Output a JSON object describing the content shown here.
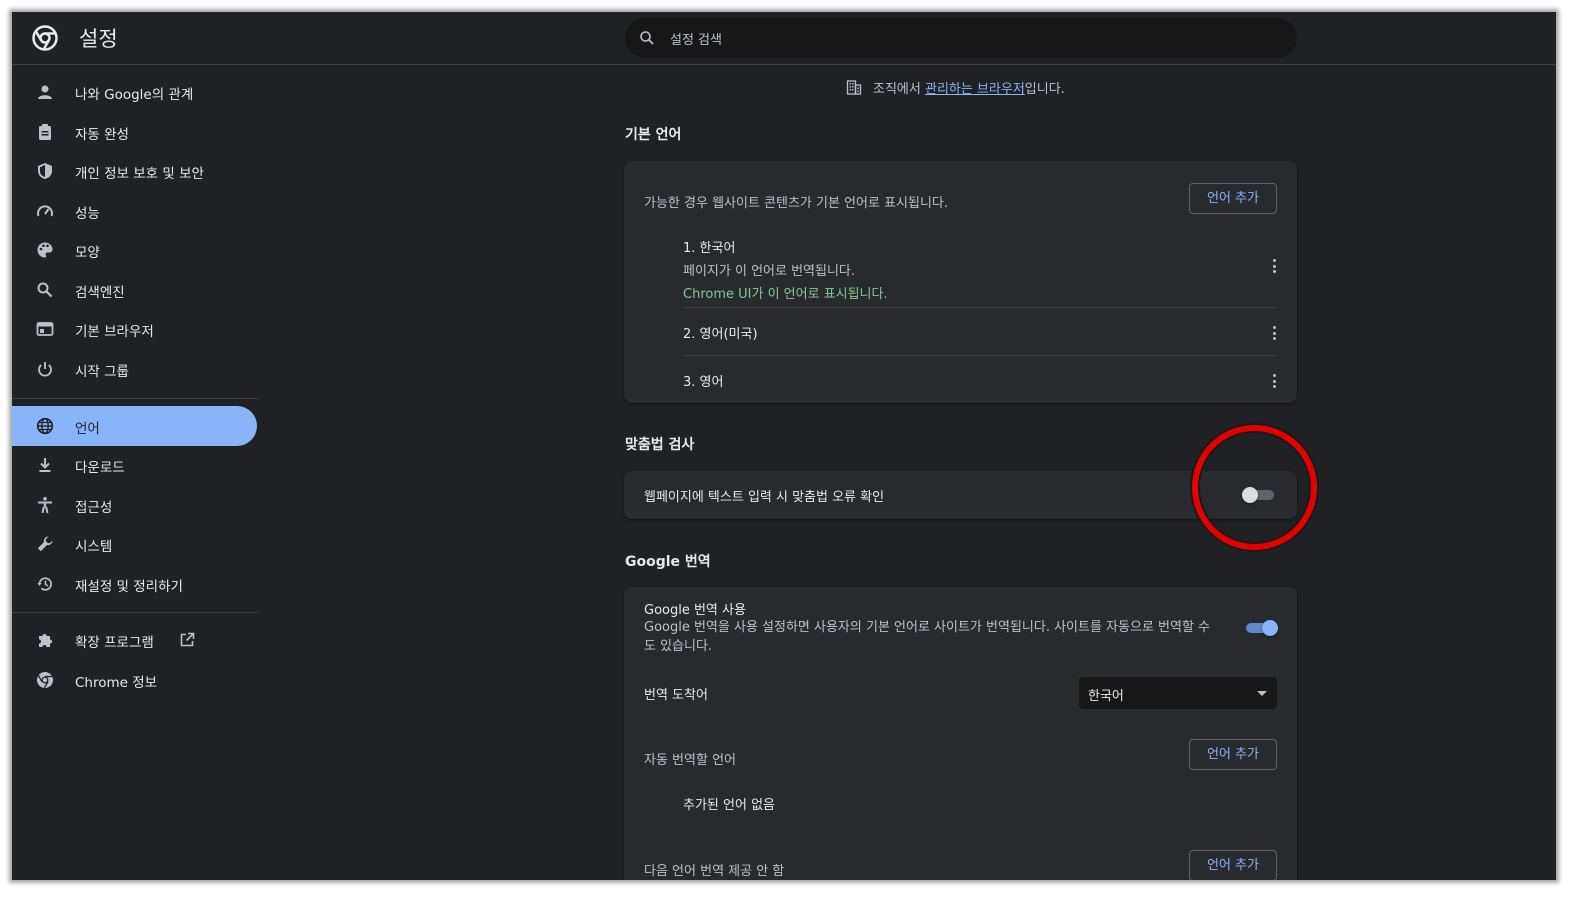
{
  "app": {
    "title": "설정"
  },
  "search": {
    "placeholder": "설정 검색"
  },
  "sidebar": {
    "items": [
      {
        "label": "나와 Google의 관계",
        "icon": "person-icon"
      },
      {
        "label": "자동 완성",
        "icon": "clipboard-icon"
      },
      {
        "label": "개인 정보 보호 및 보안",
        "icon": "shield-icon"
      },
      {
        "label": "성능",
        "icon": "speedometer-icon"
      },
      {
        "label": "모양",
        "icon": "palette-icon"
      },
      {
        "label": "검색엔진",
        "icon": "search-icon"
      },
      {
        "label": "기본 브라우저",
        "icon": "browser-icon"
      },
      {
        "label": "시작 그룹",
        "icon": "power-icon"
      },
      {
        "label": "언어",
        "icon": "globe-icon",
        "active": true
      },
      {
        "label": "다운로드",
        "icon": "download-icon"
      },
      {
        "label": "접근성",
        "icon": "accessibility-icon"
      },
      {
        "label": "시스템",
        "icon": "wrench-icon"
      },
      {
        "label": "재설정 및 정리하기",
        "icon": "history-icon"
      },
      {
        "label": "확장 프로그램",
        "icon": "puzzle-icon"
      },
      {
        "label": "Chrome 정보",
        "icon": "chrome-icon"
      }
    ]
  },
  "managed": {
    "prefix": "조직에서 ",
    "link": "관리하는 브라우저",
    "suffix": "입니다."
  },
  "preferred_languages": {
    "title": "기본 언어",
    "description": "가능한 경우 웹사이트 콘텐츠가 기본 언어로 표시됩니다.",
    "add_button": "언어 추가",
    "languages": [
      {
        "name": "1. 한국어",
        "sub1": "페이지가 이 언어로 번역됩니다.",
        "sub2": "Chrome UI가 이 언어로 표시됩니다."
      },
      {
        "name": "2. 영어(미국)"
      },
      {
        "name": "3. 영어"
      }
    ]
  },
  "spellcheck": {
    "title": "맞춤법 검사",
    "label": "웹페이지에 텍스트 입력 시 맞춤법 오류 확인",
    "enabled": false
  },
  "google_translate": {
    "title": "Google 번역",
    "use_label": "Google 번역 사용",
    "use_description": "Google 번역을 사용 설정하면 사용자의 기본 언어로 사이트가 번역됩니다. 사이트를 자동으로 번역할 수도 있습니다.",
    "enabled": true,
    "target_label": "번역 도착어",
    "target_value": "한국어",
    "auto_label": "자동 번역할 언어",
    "auto_add_button": "언어 추가",
    "auto_empty": "추가된 언어 없음",
    "never_label": "다음 언어 번역 제공 안 함",
    "never_add_button": "언어 추가"
  },
  "colors": {
    "accent": "#8ab4f8",
    "background": "#202124",
    "card": "#292a2d",
    "highlight_circle": "#e30000",
    "ui_language_note": "#81c995"
  }
}
